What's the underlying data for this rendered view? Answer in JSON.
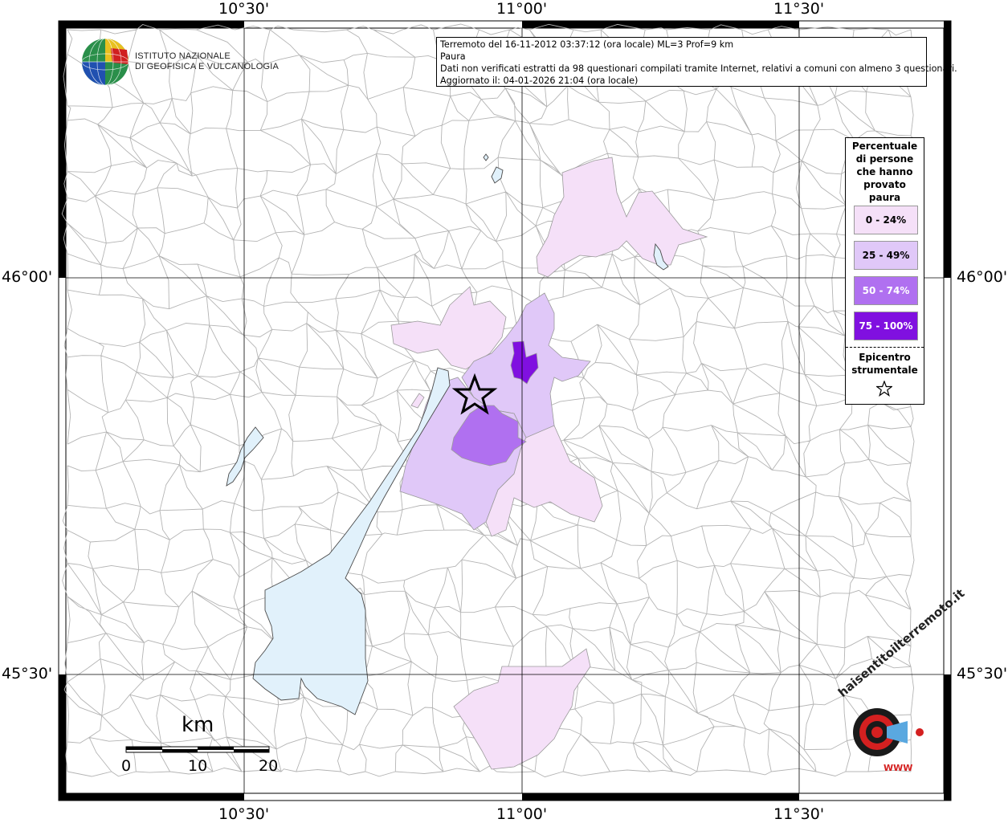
{
  "map": {
    "lon_labels": [
      "10°30'",
      "11°00'",
      "11°30'"
    ],
    "lat_labels": [
      "46°00'",
      "45°30'"
    ]
  },
  "info": {
    "line1": "Terremoto del 16-11-2012 03:37:12 (ora locale) ML=3 Prof=9 km",
    "line2": "Paura",
    "line3": "Dati non verificati estratti da 98 questionari compilati tramite Internet, relativi a comuni con almeno 3 questionari.",
    "line4": "Aggiornato il: 04-01-2026 21:04 (ora locale)"
  },
  "logo": {
    "line1": "ISTITUTO NAZIONALE",
    "line2": "DI GEOFISICA E VULCANOLOGIA"
  },
  "legend": {
    "title_lines": [
      "Percentuale",
      "di persone",
      "che hanno",
      "provato",
      "paura"
    ],
    "classes": [
      {
        "label": "0 - 24%",
        "color": "#f5e0f8"
      },
      {
        "label": "25 - 49%",
        "color": "#e0c8f8"
      },
      {
        "label": "50 - 74%",
        "color": "#b070f0"
      },
      {
        "label": "75 - 100%",
        "color": "#8010e0"
      }
    ],
    "epicenter_lines": [
      "Epicentro",
      "strumentale"
    ],
    "epicenter_icon": "star-outline-icon"
  },
  "scale": {
    "unit": "km",
    "ticks": [
      "0",
      "10",
      "20"
    ]
  },
  "watermark": {
    "brand": "haisentitoilterremoto.it",
    "sub": "WWW"
  },
  "colors": {
    "lake": "#e1f1fb",
    "grid": "#000000",
    "boundary": "#b4b4b4"
  }
}
